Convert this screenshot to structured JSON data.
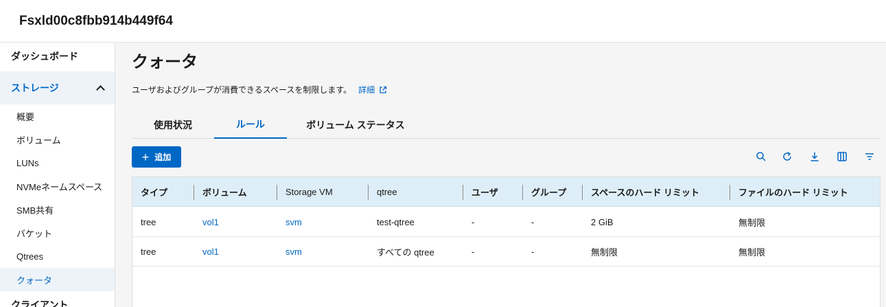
{
  "header": {
    "title": "Fsxld00c8fbb914b449f64"
  },
  "sidebar": {
    "dashboard": "ダッシュボード",
    "storage": "ストレージ",
    "items": [
      {
        "label": "概要"
      },
      {
        "label": "ボリューム"
      },
      {
        "label": "LUNs"
      },
      {
        "label": "NVMeネームスペース"
      },
      {
        "label": "SMB共有"
      },
      {
        "label": "バケット"
      },
      {
        "label": "Qtrees"
      },
      {
        "label": "クォータ"
      }
    ],
    "clients": "クライアント"
  },
  "main": {
    "title": "クォータ",
    "description": "ユーザおよびグループが消費できるスペースを制限します。",
    "detail_link": "詳細",
    "tabs": [
      {
        "label": "使用状況"
      },
      {
        "label": "ルール"
      },
      {
        "label": "ボリューム ステータス"
      }
    ],
    "add_button": "追加",
    "toolbar_icons": [
      "search-icon",
      "refresh-icon",
      "download-icon",
      "columns-icon",
      "filter-icon"
    ],
    "table": {
      "columns": [
        "タイプ",
        "ボリューム",
        "Storage VM",
        "qtree",
        "ユーザ",
        "グループ",
        "スペースのハード リミット",
        "ファイルのハード リミット"
      ],
      "rows": [
        [
          "tree",
          "vol1",
          "svm",
          "test-qtree",
          "-",
          "-",
          "2 GiB",
          "無制限"
        ],
        [
          "tree",
          "vol1",
          "svm",
          "すべての qtree",
          "-",
          "-",
          "無制限",
          "無制限"
        ]
      ]
    }
  },
  "colors": {
    "accent": "#0067c5",
    "header_bg": "#deeef9"
  }
}
